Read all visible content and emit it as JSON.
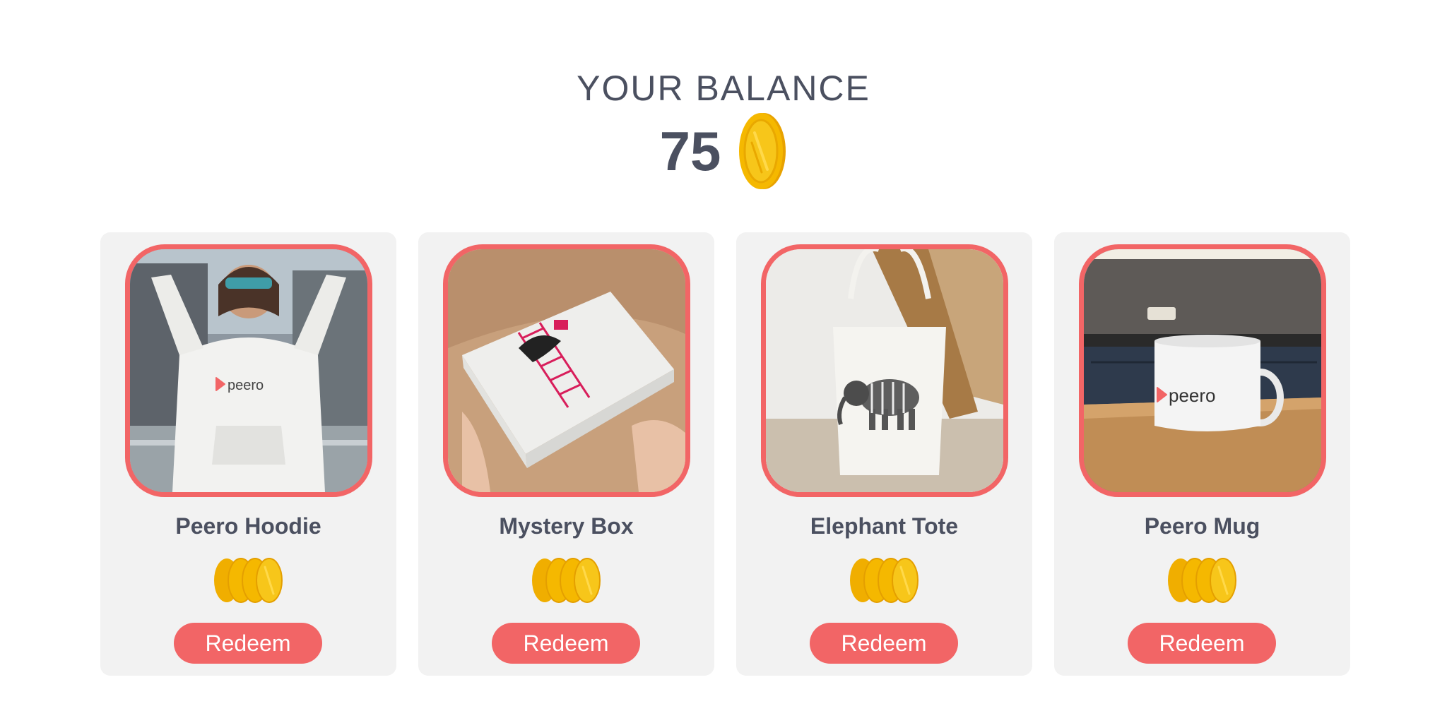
{
  "balance": {
    "title": "YOUR BALANCE",
    "amount": "75",
    "icon": "coin-icon"
  },
  "colors": {
    "accent": "#f26566",
    "coin": "#f5b800",
    "text": "#4b5060",
    "card_bg": "#f2f2f2"
  },
  "rewards": [
    {
      "name": "Peero Hoodie",
      "button_label": "Redeem",
      "brand_print": "peero",
      "image": "hoodie-photo"
    },
    {
      "name": "Mystery Box",
      "button_label": "Redeem",
      "image": "mystery-box-photo"
    },
    {
      "name": "Elephant Tote",
      "button_label": "Redeem",
      "image": "tote-bag-photo"
    },
    {
      "name": "Peero Mug",
      "button_label": "Redeem",
      "brand_print": "peero",
      "image": "mug-photo"
    }
  ]
}
